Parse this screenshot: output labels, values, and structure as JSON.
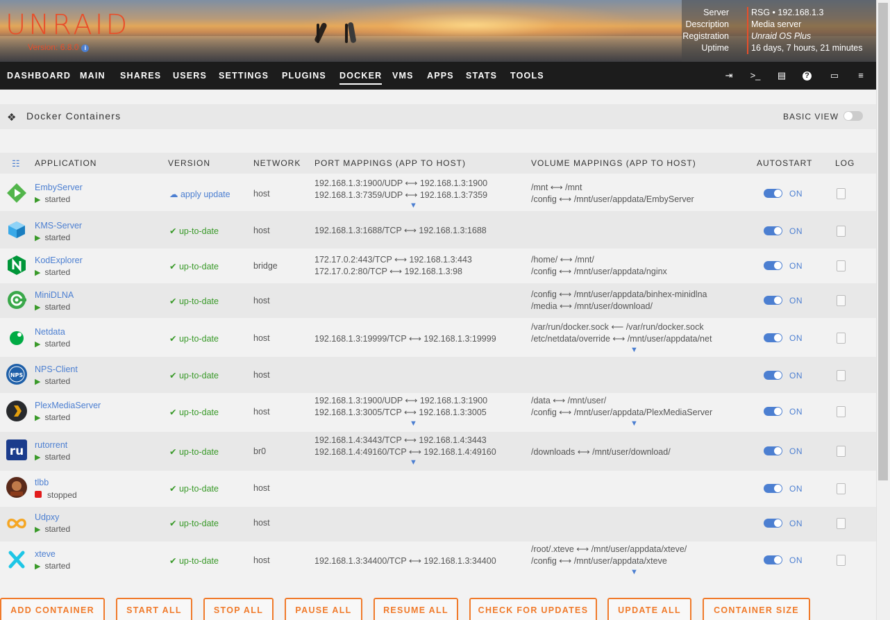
{
  "header": {
    "logo": "UNRAID",
    "version": "Version: 6.8.0",
    "server_labels": [
      "Server",
      "Description",
      "Registration",
      "Uptime"
    ],
    "server_values": [
      "RSG • 192.168.1.3",
      "Media server",
      "Unraid OS Plus",
      "16 days, 7 hours, 21 minutes"
    ]
  },
  "nav": {
    "tabs": [
      "DASHBOARD",
      "MAIN",
      "SHARES",
      "USERS",
      "SETTINGS",
      "PLUGINS",
      "DOCKER",
      "VMS",
      "APPS",
      "STATS",
      "TOOLS"
    ],
    "active": "DOCKER",
    "icons": [
      "logout-icon",
      "terminal-icon",
      "feedback-icon",
      "help-icon",
      "monitor-icon",
      "log-icon"
    ]
  },
  "section": {
    "title": "Docker Containers",
    "basic_view": "BASIC VIEW"
  },
  "table": {
    "headers": [
      "APPLICATION",
      "VERSION",
      "NETWORK",
      "PORT MAPPINGS (APP TO HOST)",
      "VOLUME MAPPINGS (APP TO HOST)",
      "AUTOSTART",
      "LOG"
    ],
    "rows": [
      {
        "name": "EmbyServer",
        "state": "started",
        "version": "apply update",
        "network": "host",
        "ports": [
          "192.168.1.3:1900/UDP ⟷ 192.168.1.3:1900",
          "192.168.1.3:7359/UDP ⟷ 192.168.1.3:7359"
        ],
        "volumes": [
          "/mnt ⟷ /mnt",
          "/config ⟷ /mnt/user/appdata/EmbyServer"
        ],
        "autostart": "ON"
      },
      {
        "name": "KMS-Server",
        "state": "started",
        "version": "up-to-date",
        "network": "host",
        "ports": [
          "192.168.1.3:1688/TCP ⟷ 192.168.1.3:1688"
        ],
        "volumes": [],
        "autostart": "ON"
      },
      {
        "name": "KodExplorer",
        "state": "started",
        "version": "up-to-date",
        "network": "bridge",
        "ports": [
          "172.17.0.2:443/TCP ⟷ 192.168.1.3:443",
          "172.17.0.2:80/TCP ⟷ 192.168.1.3:98"
        ],
        "volumes": [
          "/home/ ⟷ /mnt/",
          "/config ⟷ /mnt/user/appdata/nginx"
        ],
        "autostart": "ON"
      },
      {
        "name": "MiniDLNA",
        "state": "started",
        "version": "up-to-date",
        "network": "host",
        "ports": [],
        "volumes": [
          "/config ⟷ /mnt/user/appdata/binhex-minidlna",
          "/media ⟷ /mnt/user/download/"
        ],
        "autostart": "ON"
      },
      {
        "name": "Netdata",
        "state": "started",
        "version": "up-to-date",
        "network": "host",
        "ports": [
          "192.168.1.3:19999/TCP ⟷ 192.168.1.3:19999"
        ],
        "volumes": [
          "/var/run/docker.sock ⟵ /var/run/docker.sock",
          "/etc/netdata/override ⟷ /mnt/user/appdata/net"
        ],
        "autostart": "ON"
      },
      {
        "name": "NPS-Client",
        "state": "started",
        "version": "up-to-date",
        "network": "host",
        "ports": [],
        "volumes": [],
        "autostart": "ON"
      },
      {
        "name": "PlexMediaServer",
        "state": "started",
        "version": "up-to-date",
        "network": "host",
        "ports": [
          "192.168.1.3:1900/UDP ⟷ 192.168.1.3:1900",
          "192.168.1.3:3005/TCP ⟷ 192.168.1.3:3005"
        ],
        "volumes": [
          "/data ⟷ /mnt/user/",
          "/config ⟷ /mnt/user/appdata/PlexMediaServer"
        ],
        "autostart": "ON"
      },
      {
        "name": "rutorrent",
        "state": "started",
        "version": "up-to-date",
        "network": "br0",
        "ports": [
          "192.168.1.4:3443/TCP ⟷ 192.168.1.4:3443",
          "192.168.1.4:49160/TCP ⟷ 192.168.1.4:49160"
        ],
        "volumes": [
          "/downloads ⟷ /mnt/user/download/"
        ],
        "autostart": "ON"
      },
      {
        "name": "tlbb",
        "state": "stopped",
        "version": "up-to-date",
        "network": "host",
        "ports": [],
        "volumes": [],
        "autostart": "ON"
      },
      {
        "name": "Udpxy",
        "state": "started",
        "version": "up-to-date",
        "network": "host",
        "ports": [],
        "volumes": [],
        "autostart": "ON"
      },
      {
        "name": "xteve",
        "state": "started",
        "version": "up-to-date",
        "network": "host",
        "ports": [
          "192.168.1.3:34400/TCP ⟷ 192.168.1.3:34400"
        ],
        "volumes": [
          "/root/.xteve ⟷ /mnt/user/appdata/xteve/",
          "/config ⟷ /mnt/user/appdata/xteve"
        ],
        "autostart": "ON"
      }
    ]
  },
  "buttons": [
    "ADD CONTAINER",
    "START ALL",
    "STOP ALL",
    "PAUSE ALL",
    "RESUME ALL",
    "CHECK FOR UPDATES",
    "UPDATE ALL",
    "CONTAINER SIZE"
  ],
  "colors": {
    "accent": "#f07a2a",
    "link": "#4c7fd1",
    "ok": "#3a9a2a",
    "stopped": "#e21b1b",
    "logo": "#e84e2a"
  }
}
